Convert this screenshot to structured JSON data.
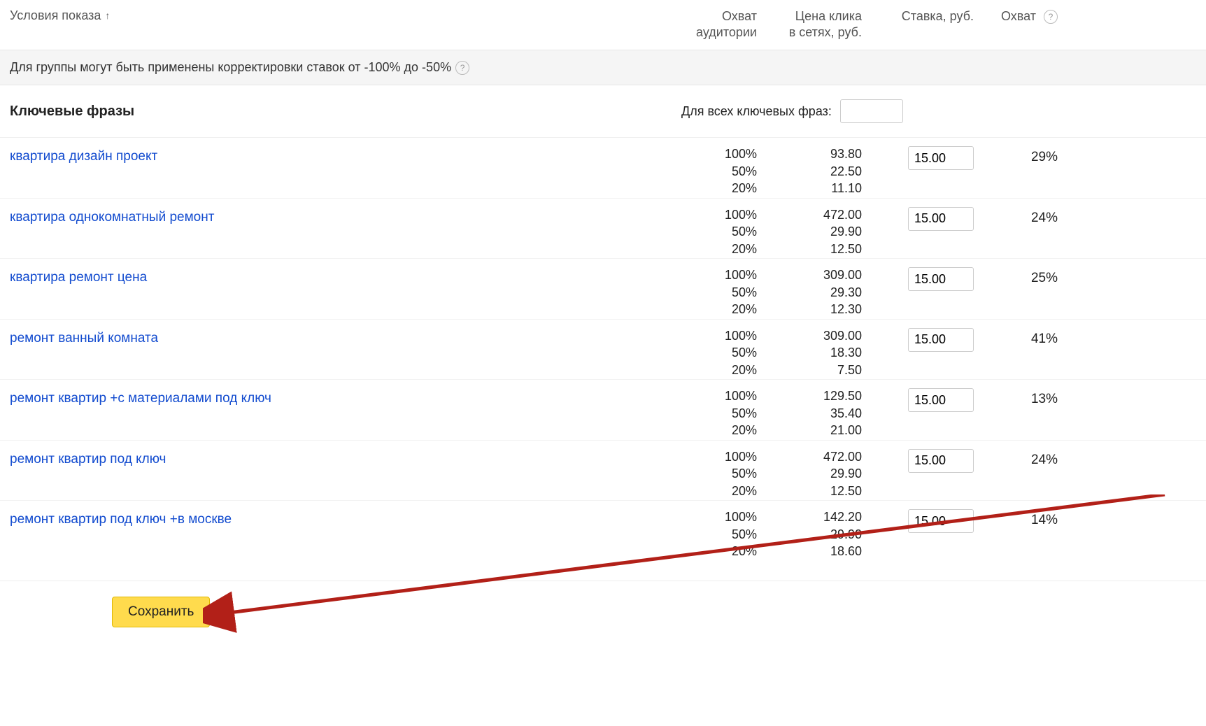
{
  "header": {
    "conditions": "Условия показа",
    "reach_audience_l1": "Охват",
    "reach_audience_l2": "аудитории",
    "click_price_l1": "Цена клика",
    "click_price_l2": "в сетях, руб.",
    "bid": "Ставка, руб.",
    "reach": "Охват"
  },
  "notice": "Для группы могут быть применены корректировки ставок от -100% до -50%",
  "section": {
    "title": "Ключевые фразы",
    "all_label": "Для всех ключевых фраз:"
  },
  "rows": [
    {
      "keyword": "квартира дизайн проект",
      "reach_audience": [
        "100%",
        "50%",
        "20%"
      ],
      "click_price": [
        "93.80",
        "22.50",
        "11.10"
      ],
      "bid": "15.00",
      "reach": "29%"
    },
    {
      "keyword": "квартира однокомнатный ремонт",
      "reach_audience": [
        "100%",
        "50%",
        "20%"
      ],
      "click_price": [
        "472.00",
        "29.90",
        "12.50"
      ],
      "bid": "15.00",
      "reach": "24%"
    },
    {
      "keyword": "квартира ремонт цена",
      "reach_audience": [
        "100%",
        "50%",
        "20%"
      ],
      "click_price": [
        "309.00",
        "29.30",
        "12.30"
      ],
      "bid": "15.00",
      "reach": "25%"
    },
    {
      "keyword": "ремонт ванный комната",
      "reach_audience": [
        "100%",
        "50%",
        "20%"
      ],
      "click_price": [
        "309.00",
        "18.30",
        "7.50"
      ],
      "bid": "15.00",
      "reach": "41%"
    },
    {
      "keyword": "ремонт квартир +с материалами под ключ",
      "reach_audience": [
        "100%",
        "50%",
        "20%"
      ],
      "click_price": [
        "129.50",
        "35.40",
        "21.00"
      ],
      "bid": "15.00",
      "reach": "13%"
    },
    {
      "keyword": "ремонт квартир под ключ",
      "reach_audience": [
        "100%",
        "50%",
        "20%"
      ],
      "click_price": [
        "472.00",
        "29.90",
        "12.50"
      ],
      "bid": "15.00",
      "reach": "24%"
    },
    {
      "keyword": "ремонт квартир под ключ +в москве",
      "reach_audience": [
        "100%",
        "50%",
        "20%"
      ],
      "click_price": [
        "142.20",
        "29.90",
        "18.60"
      ],
      "bid": "15.00",
      "reach": "14%"
    }
  ],
  "footer": {
    "save": "Сохранить"
  }
}
